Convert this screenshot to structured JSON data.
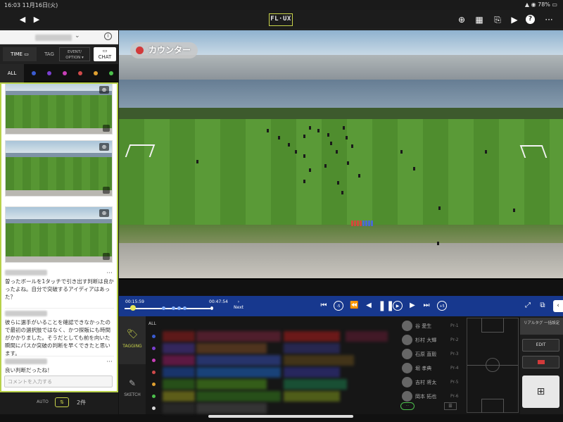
{
  "status": {
    "time": "16:03",
    "date": "11月16日(火)",
    "battery": "78%"
  },
  "topbar": {
    "logo": "FL·UX",
    "icons": [
      "zoom-icon",
      "calendar-icon",
      "cast-icon",
      "play-list-icon",
      "help-icon",
      "more-icon"
    ]
  },
  "left": {
    "modes": {
      "time": "TIME",
      "tag": "TAG",
      "event": "EVENT/ OPTION",
      "chat": "CHAT"
    },
    "filter_all": "ALL",
    "filter_colors": [
      "#3a5bd0",
      "#7a3fd0",
      "#c93fb8",
      "#d04a4a",
      "#e0a030",
      "#4cc04c"
    ],
    "comments": [
      {
        "text": "曽ったボールを1タッチで引き出す判断は良かったよね。自分で突破するアイディアはあった？"
      },
      {
        "text": "彼らに選手がいることを確認できなかったので最初の選択肢ではなく、かつ探販にも時間がかかりました。そうだとしても前を向いた瞬間にパスか突破の判断を早くできたと思います。"
      },
      {
        "text": "良い判断だったね！"
      }
    ],
    "input_placeholder": "コメントを入力する",
    "footer": {
      "auto": "AUTO",
      "count": "2件"
    }
  },
  "video": {
    "badge": "カウンター"
  },
  "timeline": {
    "current": "00:15:59",
    "end": "00:47:54",
    "next": "Next"
  },
  "bottom": {
    "tabs": {
      "tagging": "TAGGING",
      "sketch": "SKETCH"
    },
    "all": "ALL",
    "rows": [
      {
        "dot": "#3a5bd0",
        "cells": [
          [
            "#6a1a1a",
            0,
            46
          ],
          [
            "#5a2030",
            48,
            120
          ],
          [
            "#7a1a1a",
            172,
            80
          ],
          [
            "#4a1a2a",
            260,
            60
          ]
        ]
      },
      {
        "dot": "#7a3fd0",
        "cells": [
          [
            "#3a2a6a",
            0,
            46
          ],
          [
            "#5a3a20",
            48,
            100
          ],
          [
            "#2a2a5a",
            172,
            80
          ]
        ]
      },
      {
        "dot": "#c93fb8",
        "cells": [
          [
            "#6a1a4a",
            0,
            46
          ],
          [
            "#2a3a7a",
            48,
            120
          ],
          [
            "#4a3a1a",
            172,
            100
          ]
        ]
      },
      {
        "dot": "#d04a4a",
        "cells": [
          [
            "#1a3a7a",
            0,
            46
          ],
          [
            "#1a4a8a",
            48,
            120
          ],
          [
            "#2a2a6a",
            172,
            80
          ]
        ]
      },
      {
        "dot": "#e0a030",
        "cells": [
          [
            "#2a5a1a",
            0,
            46
          ],
          [
            "#3a6a1a",
            48,
            100
          ],
          [
            "#1a5a3a",
            172,
            90
          ]
        ]
      },
      {
        "dot": "#4cc04c",
        "cells": [
          [
            "#6a6a1a",
            0,
            46
          ],
          [
            "#2a5a1a",
            48,
            120
          ],
          [
            "#5a6a1a",
            172,
            80
          ]
        ]
      },
      {
        "dot": "#d8d8d8",
        "cells": [
          [
            "#2a2a2a",
            0,
            46
          ],
          [
            "#3a3a3a",
            48,
            100
          ]
        ]
      }
    ],
    "players": [
      {
        "name": "谷 愛生",
        "num": "Pr-1"
      },
      {
        "name": "杉村 大輝",
        "num": "Pr-2"
      },
      {
        "name": "石原 直毅",
        "num": "Pr-3"
      },
      {
        "name": "堀 孝典",
        "num": "Pr-4"
      },
      {
        "name": "吉村 将太",
        "num": "Pr-5"
      },
      {
        "name": "岡本 拓也",
        "num": "Pr-6"
      }
    ],
    "realtime": "リアルタグ 一括設定",
    "edit": "EDIT"
  }
}
